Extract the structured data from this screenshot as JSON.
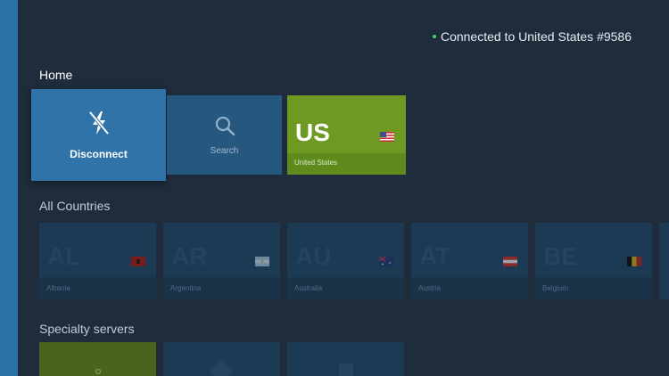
{
  "status": {
    "text": "Connected to United States #9586",
    "dot_color": "#48d160"
  },
  "home": {
    "title": "Home",
    "disconnect_label": "Disconnect",
    "search_label": "Search",
    "current": {
      "code": "US",
      "name": "United States"
    }
  },
  "countries": {
    "title": "All Countries",
    "items": [
      {
        "code": "AL",
        "name": "Albania"
      },
      {
        "code": "AR",
        "name": "Argentina"
      },
      {
        "code": "AU",
        "name": "Australia"
      },
      {
        "code": "AT",
        "name": "Austria"
      },
      {
        "code": "BE",
        "name": "Belgium"
      }
    ]
  },
  "specialty": {
    "title": "Specialty servers"
  },
  "colors": {
    "background": "#1f2c3b",
    "accent_blue": "#2f73a8",
    "accent_green": "#6e9a23"
  },
  "icons": {
    "disconnect": "lightning-off-icon",
    "search": "search-icon"
  }
}
